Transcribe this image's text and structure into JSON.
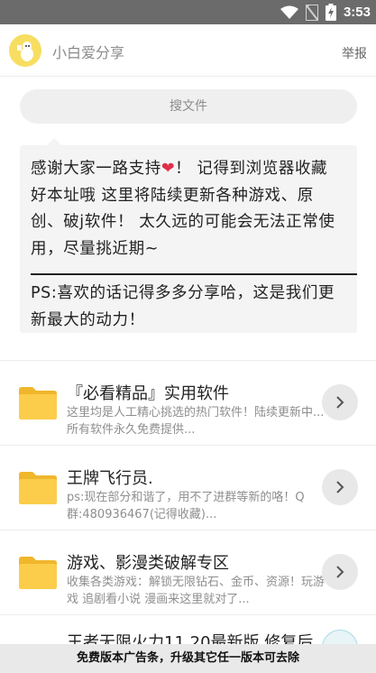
{
  "status_bar": {
    "time": "3:53",
    "icons": [
      "wifi-icon",
      "no-sim-icon",
      "battery-charging-icon"
    ]
  },
  "app_bar": {
    "title": "小白爱分享",
    "report_label": "举报",
    "avatar_icon": "cartoon-avatar-icon"
  },
  "search": {
    "placeholder": "搜文件"
  },
  "notice": {
    "line1_before_heart": "感谢大家一路支持",
    "heart": "❤",
    "line1_after_heart": "！ 记得到浏览器收藏",
    "line2": "好本址哦 这里将陆续更新各种游戏、原",
    "line3": "创、破j软件！ 太久远的可能会无法正常使",
    "line4": "用，尽量挑近期~",
    "line5": "PS:喜欢的话记得多多分享哈，这是我们更",
    "line6": "新最大的动力！"
  },
  "folders": [
    {
      "title": "『必看精品』实用软件",
      "desc": "这里均是人工精心挑选的热门软件！陆续更新中...所有软件永久免费提供..."
    },
    {
      "title": "王牌飞行员.",
      "desc": "ps:现在部分和谐了，用不了进群等新的咯！Q群:480936467(记得收藏)..."
    },
    {
      "title": "游戏、影漫类破解专区",
      "desc": "收集各类游戏：解锁无限钻石、金币、资源！玩游戏 追剧看小说 漫画来这里就对了..."
    },
    {
      "title": "王者无限火力11.20最新版 修复后",
      "desc": ""
    }
  ],
  "ad_bar": {
    "text": "免费版本广告条，升级其它任一版本可去除"
  },
  "colors": {
    "status_bar": "#6b6b6b",
    "folder_yellow": "#f9c53a",
    "avatar_bg": "#f7de62",
    "heart_red": "#e0304a"
  }
}
